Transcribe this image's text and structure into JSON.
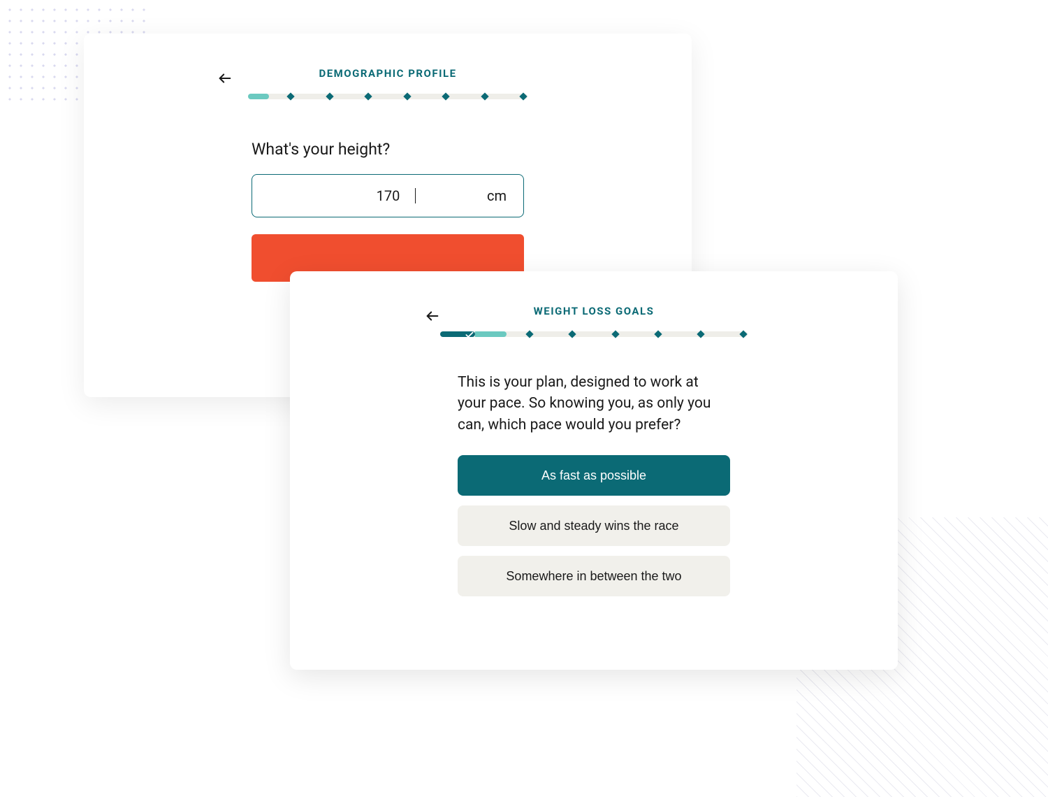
{
  "colors": {
    "teal": "#0b6a75",
    "teal_light": "#6bc9c0",
    "orange": "#f04e2f",
    "neutral_bg": "#f1f0eb"
  },
  "card1": {
    "section_title": "DEMOGRAPHIC PROFILE",
    "progress": {
      "steps": 8,
      "completed": 1
    },
    "question": "What's your height?",
    "input": {
      "value": "170",
      "unit": "cm"
    },
    "primary_button_label": ""
  },
  "card2": {
    "section_title": "WEIGHT LOSS GOALS",
    "progress": {
      "steps": 8,
      "completed": 2,
      "checked_step": 1
    },
    "intro_text": "This is your plan, designed to work at your pace. So knowing you, as only you can, which pace would you prefer?",
    "options": [
      {
        "label": "As fast as possible",
        "selected": true
      },
      {
        "label": "Slow and steady wins the race",
        "selected": false
      },
      {
        "label": "Somewhere in between the two",
        "selected": false
      }
    ]
  }
}
